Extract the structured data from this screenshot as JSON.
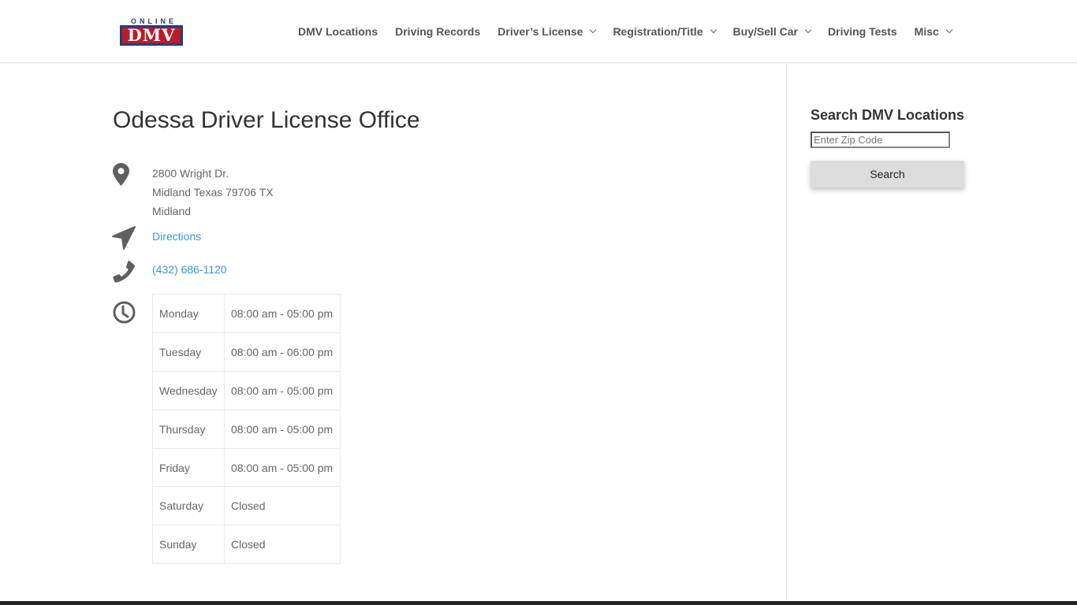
{
  "brand": {
    "logo_top": "ONLINE",
    "logo_main": "DMV",
    "colors": {
      "red": "#b81d2c",
      "navy": "#2a3a7a"
    }
  },
  "nav": {
    "items": [
      {
        "label": "DMV Locations",
        "dropdown": false
      },
      {
        "label": "Driving Records",
        "dropdown": false
      },
      {
        "label": "Driver’s License",
        "dropdown": true
      },
      {
        "label": "Registration/Title",
        "dropdown": true
      },
      {
        "label": "Buy/Sell Car",
        "dropdown": true
      },
      {
        "label": "Driving Tests",
        "dropdown": false
      },
      {
        "label": "Misc",
        "dropdown": true
      }
    ]
  },
  "office": {
    "title": "Odessa Driver License Office",
    "address": {
      "line1": "2800 Wright Dr.",
      "line2": "Midland Texas 79706 TX",
      "line3": "Midland"
    },
    "directions_label": "Directions",
    "phone": "(432) 686-1120",
    "link_color": "#3a94d8",
    "hours": [
      {
        "day": "Monday",
        "time": "08:00 am - 05:00 pm"
      },
      {
        "day": "Tuesday",
        "time": "08:00 am - 06:00 pm"
      },
      {
        "day": "Wednesday",
        "time": "08:00 am - 05:00 pm"
      },
      {
        "day": "Thursday",
        "time": "08:00 am - 05:00 pm"
      },
      {
        "day": "Friday",
        "time": "08:00 am - 05:00 pm"
      },
      {
        "day": "Saturday",
        "time": "Closed"
      },
      {
        "day": "Sunday",
        "time": "Closed"
      }
    ]
  },
  "sidebar": {
    "title": "Search DMV Locations",
    "zip_placeholder": "Enter Zip Code",
    "zip_value": "",
    "search_label": "Search"
  },
  "icons": {
    "address": "map-pin-icon",
    "directions": "location-arrow-icon",
    "phone": "phone-icon",
    "hours": "clock-icon"
  }
}
